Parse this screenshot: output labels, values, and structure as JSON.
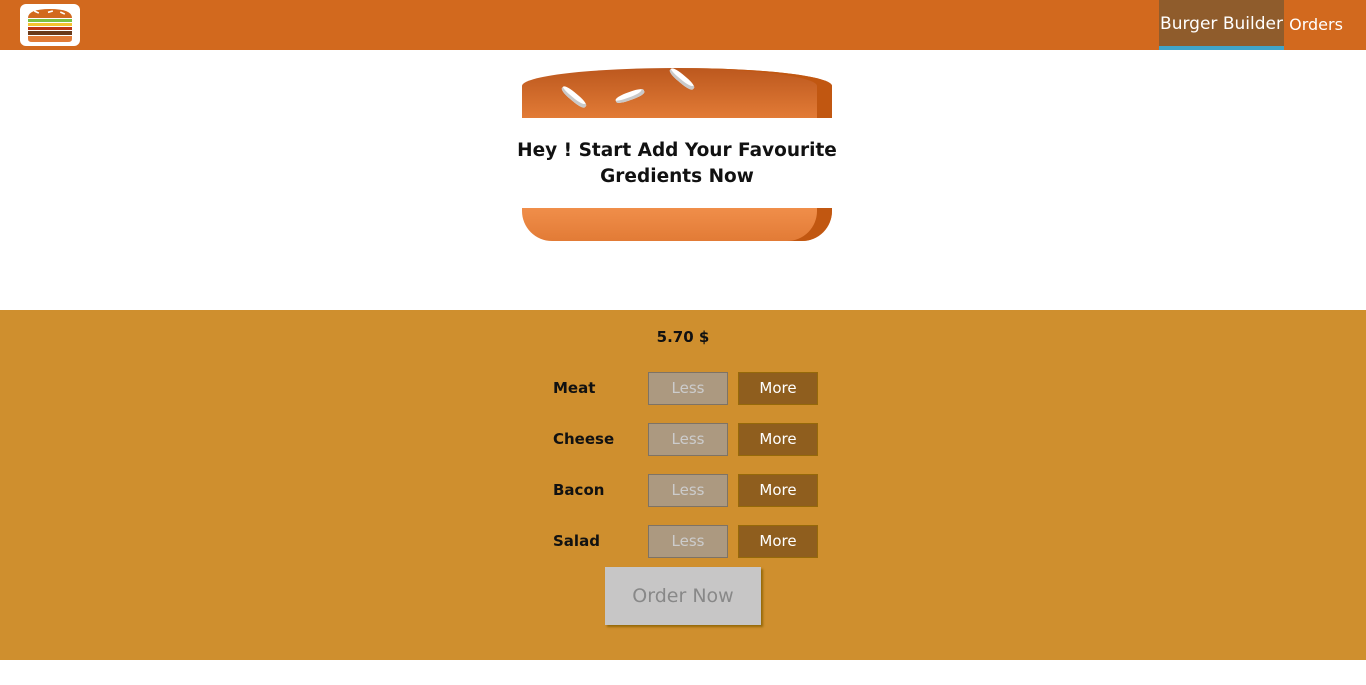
{
  "toolbar": {
    "logo_icon": "burger-logo-icon",
    "nav": [
      {
        "label": "Burger Builder",
        "active": true
      },
      {
        "label": "Orders",
        "active": false
      }
    ]
  },
  "burger": {
    "message": "Hey ! Start Add Your Favourite Gredients Now"
  },
  "controls": {
    "price": "5.70 $",
    "items": [
      {
        "label": "Meat",
        "less": "Less",
        "more": "More"
      },
      {
        "label": "Cheese",
        "less": "Less",
        "more": "More"
      },
      {
        "label": "Bacon",
        "less": "Less",
        "more": "More"
      },
      {
        "label": "Salad",
        "less": "Less",
        "more": "More"
      }
    ],
    "order_label": "Order Now"
  },
  "colors": {
    "toolbar": "#d2691e",
    "controls_bg": "#cf8f2e",
    "more_button": "#8f5e1e",
    "less_button_disabled": "#ac9980",
    "active_nav_underline": "#40a4c8"
  }
}
